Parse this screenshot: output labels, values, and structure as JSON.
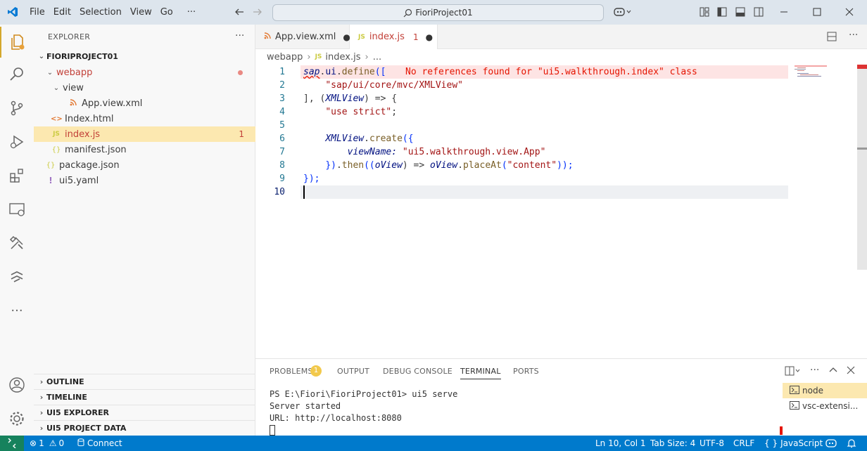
{
  "titlebar": {
    "menu": [
      "File",
      "Edit",
      "Selection",
      "View",
      "Go"
    ],
    "more": "···",
    "search_text": "FioriProject01"
  },
  "explorer": {
    "title": "EXPLORER",
    "more": "···",
    "project": "FIORIPROJECT01",
    "tree": [
      {
        "label": "webapp",
        "indent": 1,
        "chev": "⌄",
        "icon": "",
        "kind": "folder-modified"
      },
      {
        "label": "view",
        "indent": 2,
        "chev": "⌄",
        "icon": "",
        "kind": "folder"
      },
      {
        "label": "App.view.xml",
        "indent": 3,
        "chev": "",
        "icon": "rss-icon",
        "kind": "xml"
      },
      {
        "label": "Index.html",
        "indent": 2,
        "chev": "",
        "icon": "html-icon",
        "kind": "html"
      },
      {
        "label": "index.js",
        "indent": 2,
        "chev": "",
        "icon": "js-icon",
        "kind": "js-selected",
        "badge": "1"
      },
      {
        "label": "manifest.json",
        "indent": 2,
        "chev": "",
        "icon": "json-icon",
        "kind": "json"
      },
      {
        "label": "package.json",
        "indent": 1,
        "chev": "",
        "icon": "json-icon",
        "kind": "json"
      },
      {
        "label": "ui5.yaml",
        "indent": 1,
        "chev": "",
        "icon": "yaml-icon",
        "kind": "yaml"
      }
    ],
    "panels": [
      "OUTLINE",
      "TIMELINE",
      "UI5 EXPLORER",
      "UI5 PROJECT DATA"
    ]
  },
  "tabs": [
    {
      "label": "App.view.xml",
      "dot": "●"
    },
    {
      "label": "index.js",
      "badge": "1",
      "dot": "●"
    }
  ],
  "breadcrumb": {
    "folder": "webapp",
    "file": "index.js",
    "tail": "..."
  },
  "editor": {
    "line_numbers": [
      "1",
      "2",
      "3",
      "4",
      "5",
      "6",
      "7",
      "8",
      "9",
      "10"
    ],
    "diagnostic": "No references found for \"ui5.walkthrough.index\" class",
    "lines": {
      "l1a": "sap",
      "l1b": ".",
      "l1c": "ui",
      "l1d": ".",
      "l1e": "define",
      "l1f": "([",
      "l2": "\"sap/ui/core/mvc/XMLView\"",
      "l3a": "], (",
      "l3b": "XMLView",
      "l3c": ") => {",
      "l4a": "\"use strict\"",
      "l4b": ";",
      "l6a": "XMLView",
      "l6b": ".",
      "l6c": "create",
      "l6d": "({",
      "l7a": "viewName:",
      "l7b": " ",
      "l7c": "\"ui5.walkthrough.view.App\"",
      "l8a": "})",
      "l8b": ".",
      "l8c": "then",
      "l8d": "((",
      "l8e": "oView",
      "l8f": ") => ",
      "l8g": "oView",
      "l8h": ".",
      "l8i": "placeAt",
      "l8j": "(",
      "l8k": "\"content\"",
      "l8l": "));",
      "l9": "});"
    }
  },
  "panel": {
    "tabs": [
      "PROBLEMS",
      "OUTPUT",
      "DEBUG CONSOLE",
      "TERMINAL",
      "PORTS"
    ],
    "problems_count": "1",
    "terminal_lines": [
      "PS E:\\Fiori\\FioriProject01> ui5 serve",
      "Server started",
      "URL: http://localhost:8080"
    ],
    "terminals": [
      "node",
      "vsc-extensi..."
    ],
    "more": "···"
  },
  "status": {
    "errors": "1",
    "warnings": "0",
    "connect": "Connect",
    "position": "Ln 10, Col 1",
    "tab_size": "Tab Size: 4",
    "encoding": "UTF-8",
    "eol": "CRLF",
    "language_braces": "{ }",
    "language": "JavaScript"
  }
}
